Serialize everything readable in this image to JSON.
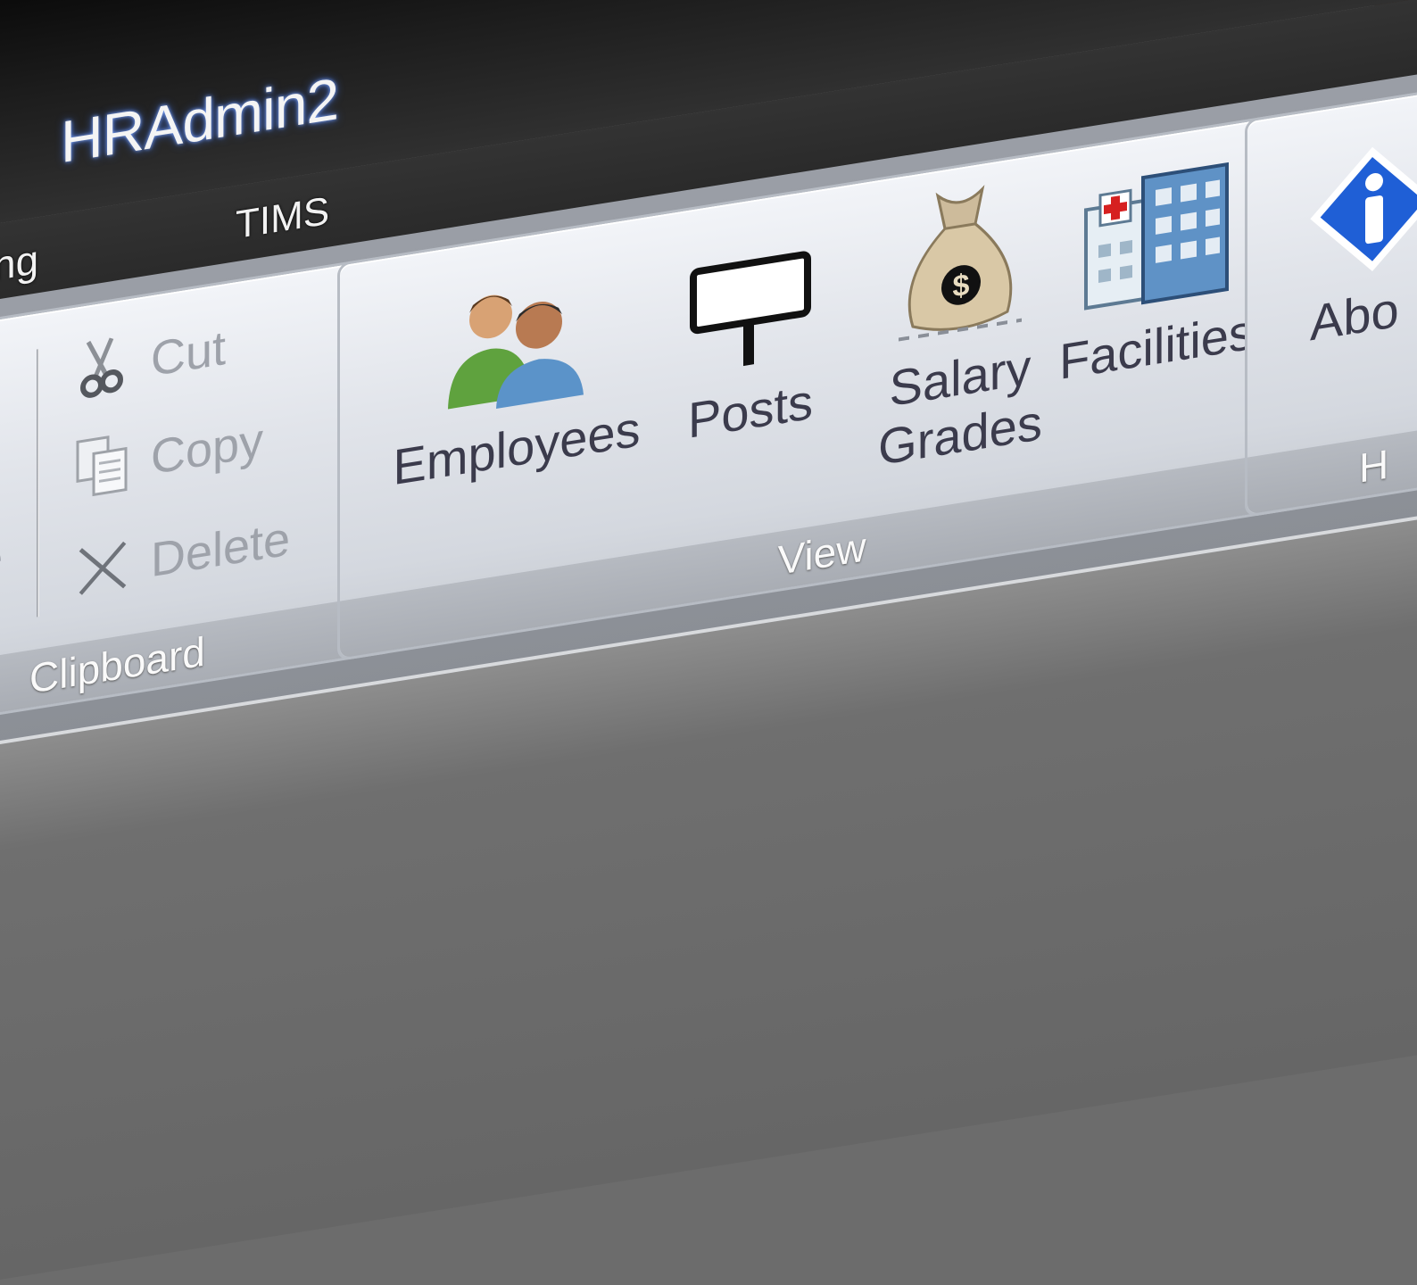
{
  "window": {
    "title": "HRAdmin2"
  },
  "tabs": [
    {
      "label": "ng"
    },
    {
      "label": "TIMS"
    }
  ],
  "ribbon": {
    "clipboard": {
      "label": "Clipboard",
      "partial_button": "e",
      "buttons": [
        {
          "label": "Cut",
          "icon": "scissors-icon",
          "enabled": false
        },
        {
          "label": "Copy",
          "icon": "copy-icon",
          "enabled": false
        },
        {
          "label": "Delete",
          "icon": "delete-x-icon",
          "enabled": false
        }
      ]
    },
    "view": {
      "label": "View",
      "buttons": [
        {
          "label": "Employees",
          "icon": "employees-icon"
        },
        {
          "label": "Posts",
          "icon": "signpost-icon"
        },
        {
          "label_line1": "Salary",
          "label_line2": "Grades",
          "icon": "money-bag-icon"
        },
        {
          "label": "Facilities",
          "icon": "building-icon"
        }
      ]
    },
    "help": {
      "label": "H",
      "buttons": [
        {
          "label": "Abo",
          "icon": "info-icon"
        }
      ]
    }
  },
  "colors": {
    "title_glow": "#3b64c8",
    "ribbon_group": "#e1e4ea",
    "disabled_text": "#9ea2aa",
    "button_text": "#3b3b4c",
    "info_blue": "#1f5fd6"
  }
}
